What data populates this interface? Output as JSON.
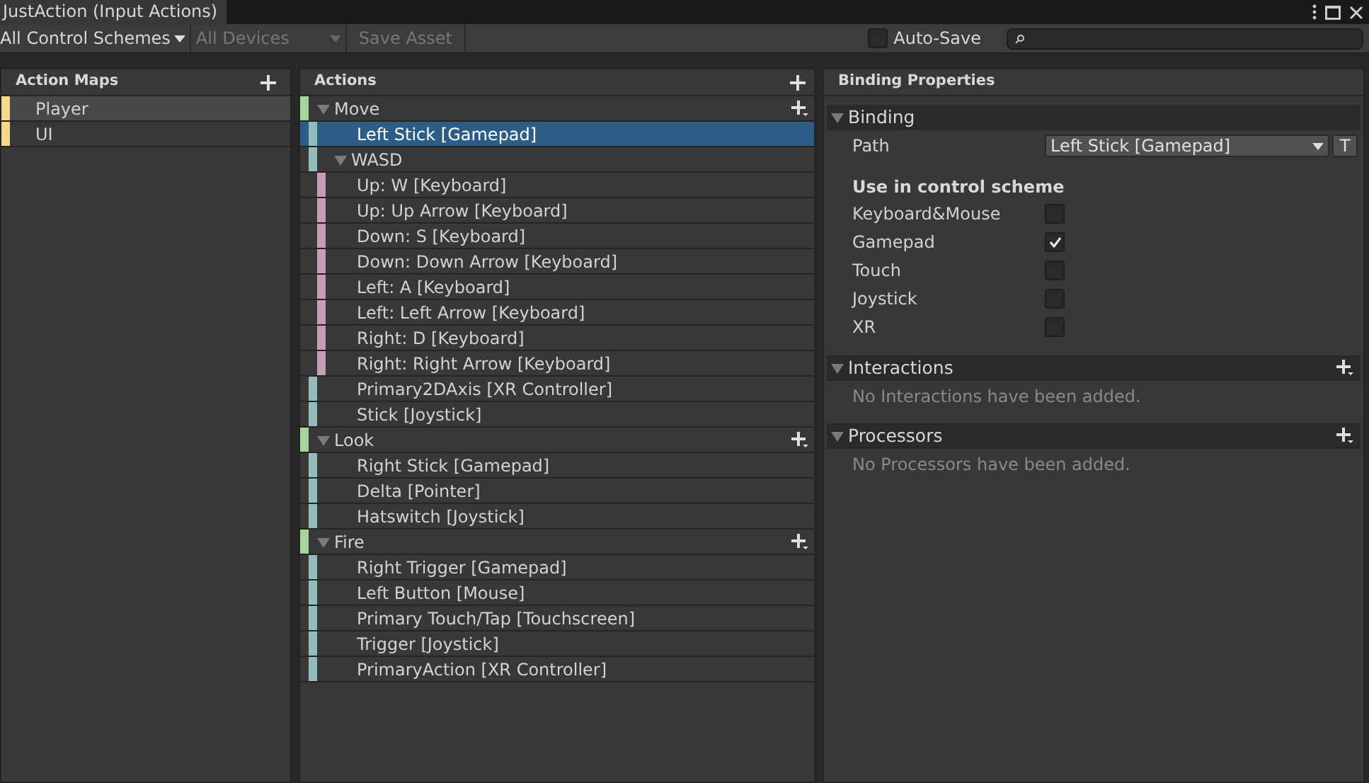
{
  "window": {
    "title": "JustAction (Input Actions)"
  },
  "toolbar": {
    "control_scheme": "All Control Schemes",
    "devices": {
      "label": "All Devices",
      "disabled": true
    },
    "save_asset": {
      "label": "Save Asset",
      "disabled": true
    },
    "auto_save": {
      "label": "Auto-Save",
      "checked": false
    }
  },
  "action_maps": {
    "title": "Action Maps",
    "items": [
      {
        "name": "Player",
        "selected": true
      },
      {
        "name": "UI",
        "selected": false
      }
    ]
  },
  "actions": {
    "title": "Actions",
    "items": [
      {
        "kind": "action",
        "name": "Move",
        "expanded": true,
        "selected": false,
        "children": [
          {
            "kind": "binding",
            "name": "Left Stick [Gamepad]",
            "selected": true
          },
          {
            "kind": "binding",
            "name": "WASD",
            "expanded": true,
            "selected": false,
            "children": [
              {
                "kind": "part",
                "name": "Up: W [Keyboard]",
                "selected": false
              },
              {
                "kind": "part",
                "name": "Up: Up Arrow [Keyboard]",
                "selected": false
              },
              {
                "kind": "part",
                "name": "Down: S [Keyboard]",
                "selected": false
              },
              {
                "kind": "part",
                "name": "Down: Down Arrow [Keyboard]",
                "selected": false
              },
              {
                "kind": "part",
                "name": "Left: A [Keyboard]",
                "selected": false
              },
              {
                "kind": "part",
                "name": "Left: Left Arrow [Keyboard]",
                "selected": false
              },
              {
                "kind": "part",
                "name": "Right: D [Keyboard]",
                "selected": false
              },
              {
                "kind": "part",
                "name": "Right: Right Arrow [Keyboard]",
                "selected": false
              }
            ]
          },
          {
            "kind": "binding",
            "name": "Primary2DAxis [XR Controller]",
            "selected": false
          },
          {
            "kind": "binding",
            "name": "Stick [Joystick]",
            "selected": false
          }
        ]
      },
      {
        "kind": "action",
        "name": "Look",
        "expanded": true,
        "selected": false,
        "children": [
          {
            "kind": "binding",
            "name": "Right Stick [Gamepad]",
            "selected": false
          },
          {
            "kind": "binding",
            "name": "Delta [Pointer]",
            "selected": false
          },
          {
            "kind": "binding",
            "name": "Hatswitch [Joystick]",
            "selected": false
          }
        ]
      },
      {
        "kind": "action",
        "name": "Fire",
        "expanded": true,
        "selected": false,
        "children": [
          {
            "kind": "binding",
            "name": "Right Trigger [Gamepad]",
            "selected": false
          },
          {
            "kind": "binding",
            "name": "Left Button [Mouse]",
            "selected": false
          },
          {
            "kind": "binding",
            "name": "Primary Touch/Tap [Touchscreen]",
            "selected": false
          },
          {
            "kind": "binding",
            "name": "Trigger [Joystick]",
            "selected": false
          },
          {
            "kind": "binding",
            "name": "PrimaryAction [XR Controller]",
            "selected": false
          }
        ]
      }
    ]
  },
  "binding_properties": {
    "title": "Binding Properties",
    "binding": {
      "title": "Binding",
      "expanded": true,
      "path_label": "Path",
      "path_value": "Left Stick [Gamepad]",
      "t_button": "T",
      "scheme_heading": "Use in control scheme",
      "schemes": [
        {
          "name": "Keyboard&Mouse",
          "checked": false
        },
        {
          "name": "Gamepad",
          "checked": true
        },
        {
          "name": "Touch",
          "checked": false
        },
        {
          "name": "Joystick",
          "checked": false
        },
        {
          "name": "XR",
          "checked": false
        }
      ]
    },
    "interactions": {
      "title": "Interactions",
      "expanded": true,
      "empty": "No Interactions have been added."
    },
    "processors": {
      "title": "Processors",
      "expanded": true,
      "empty": "No Processors have been added."
    }
  }
}
